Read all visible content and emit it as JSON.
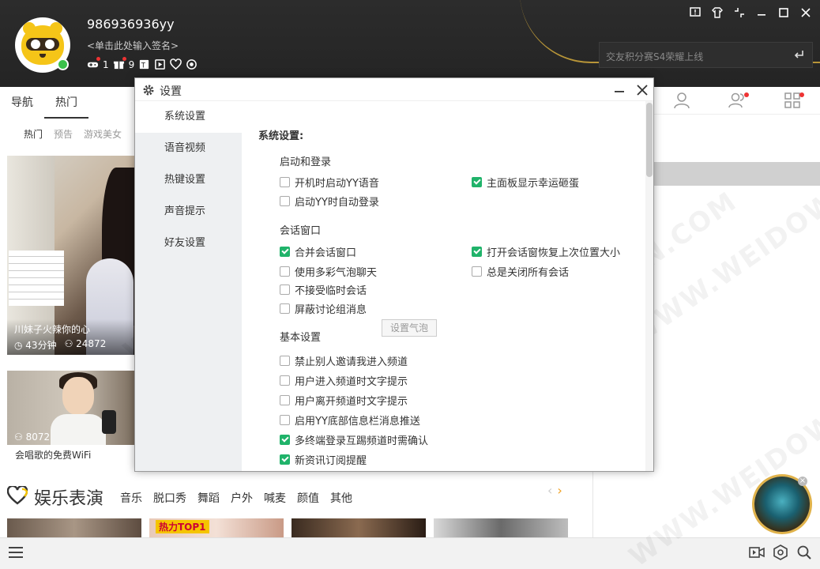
{
  "header": {
    "username": "986936936yy",
    "signature": "<单击此处输入签名>",
    "status_counts": {
      "friends": "1",
      "gifts": "9"
    },
    "search_placeholder": "交友积分赛S4荣耀上线",
    "window_controls": [
      "feedback-icon",
      "skin-icon",
      "mini-mode-icon",
      "minimize-icon",
      "maximize-icon",
      "close-icon"
    ]
  },
  "nav": {
    "tabs": [
      "导航",
      "热门"
    ],
    "subtabs": [
      "热门",
      "预告",
      "游戏美女"
    ]
  },
  "streams": [
    {
      "title": "川妹子火辣你的心",
      "duration": "43分钟",
      "viewers": "24872"
    },
    {
      "title": "会唱歌的免费WiFi",
      "viewers": "8072"
    }
  ],
  "entertainment": {
    "title": "娱乐表演",
    "categories": [
      "音乐",
      "脱口秀",
      "舞蹈",
      "户外",
      "喊麦",
      "颜值",
      "其他"
    ],
    "prev": "‹",
    "next": "›",
    "thumb_tag": "热力TOP1"
  },
  "dialog": {
    "title": "设置",
    "nav_items": [
      "系统设置",
      "语音视频",
      "热键设置",
      "声音提示",
      "好友设置"
    ],
    "section_title": "系统设置:",
    "groups": {
      "startup": "启动和登录",
      "session": "会话窗口",
      "basic": "基本设置"
    },
    "options": {
      "auto_start": "开机时启动YY语音",
      "show_egg": "主面板显示幸运砸蛋",
      "auto_login": "启动YY时自动登录",
      "merge_session": "合并会话窗口",
      "restore_size": "打开会话窗恢复上次位置大小",
      "bubble_chat": "使用多彩气泡聊天",
      "bubble_button": "设置气泡",
      "close_all": "总是关闭所有会话",
      "no_temp": "不接受临时会话",
      "block_group": "屏蔽讨论组消息",
      "no_invite": "禁止别人邀请我进入频道",
      "enter_tip": "用户进入频道时文字提示",
      "leave_tip": "用户离开频道时文字提示",
      "bottom_push": "启用YY底部信息栏消息推送",
      "multi_login": "多终端登录互踢频道时需确认",
      "news_sub": "新资讯订阅提醒"
    }
  },
  "watermark_text": "WWW.WEIDOWN.COM",
  "colors": {
    "accent_green": "#20b36a",
    "header_bg": "#2c2c2c",
    "gold": "#c8a23a",
    "red_dot": "#e33"
  }
}
